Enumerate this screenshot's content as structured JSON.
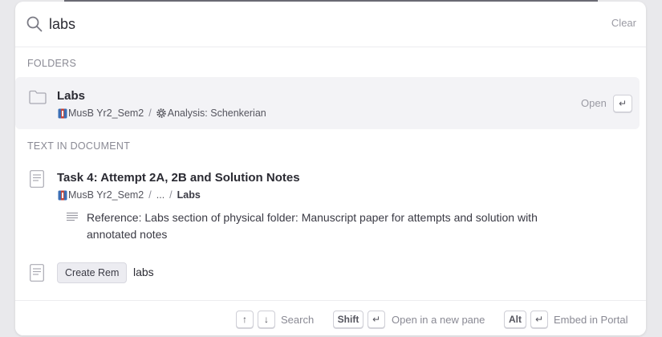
{
  "search": {
    "value": "labs",
    "clear_label": "Clear"
  },
  "sections": {
    "folders_label": "FOLDERS",
    "text_label": "TEXT IN DOCUMENT"
  },
  "folder_result": {
    "title": "Labs",
    "crumb1": "MusB Yr2_Sem2",
    "crumb_sep": "/",
    "crumb2": "Analysis: Schenkerian",
    "open_label": "Open",
    "enter_key": "↵"
  },
  "doc_result": {
    "title": "Task 4: Attempt 2A, 2B and Solution Notes",
    "crumb1": "MusB Yr2_Sem2",
    "crumb_sep": "/",
    "crumb_ellipsis": "...",
    "crumb_last": "Labs",
    "snippet": "Reference: Labs section of physical folder: Manuscript paper for attempts and solution with annotated notes"
  },
  "create": {
    "button_label": "Create Rem",
    "text": "labs"
  },
  "footer": {
    "up_key": "↑",
    "down_key": "↓",
    "search_label": "Search",
    "shift_key": "Shift",
    "enter_key": "↵",
    "new_pane_label": "Open in a new pane",
    "alt_key": "Alt",
    "enter_key2": "↵",
    "portal_label": "Embed in Portal"
  },
  "colors": {
    "selected_row_bg": "#f3f3f6",
    "muted_text": "#8a8a94",
    "icon_blue": "#3b6fb6",
    "icon_red": "#c0463c"
  },
  "icons": {
    "search": "search-icon",
    "folder": "folder-icon",
    "doc": "document-icon",
    "snippet": "text-lines-icon",
    "book": "book-icon",
    "gear": "gear-icon"
  }
}
